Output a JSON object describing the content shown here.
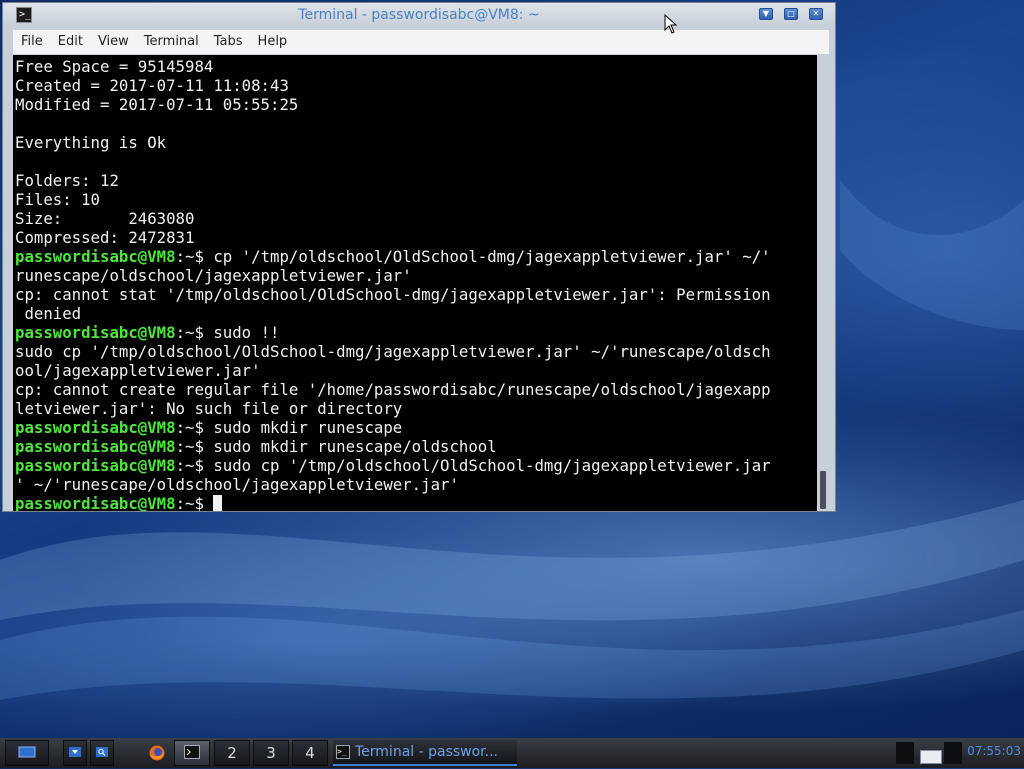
{
  "window": {
    "title": "Terminal - passwordisabc@VM8: ~",
    "icon": "terminal-icon"
  },
  "menu": [
    "File",
    "Edit",
    "View",
    "Terminal",
    "Tabs",
    "Help"
  ],
  "terminal": {
    "lines": [
      {
        "text": "Free Space = 95145984"
      },
      {
        "text": "Created = 2017-07-11 11:08:43"
      },
      {
        "text": "Modified = 2017-07-11 05:55:25"
      },
      {
        "text": ""
      },
      {
        "text": "Everything is Ok"
      },
      {
        "text": ""
      },
      {
        "text": "Folders: 12"
      },
      {
        "text": "Files: 10"
      },
      {
        "text": "Size:       2463080"
      },
      {
        "text": "Compressed: 2472831"
      },
      {
        "prompt": "passwordisabc@VM8",
        "path": ":~$ ",
        "text": "cp '/tmp/oldschool/OldSchool-dmg/jagexappletviewer.jar' ~/'"
      },
      {
        "text": "runescape/oldschool/jagexappletviewer.jar'"
      },
      {
        "text": "cp: cannot stat '/tmp/oldschool/OldSchool-dmg/jagexappletviewer.jar': Permission"
      },
      {
        "text": " denied"
      },
      {
        "prompt": "passwordisabc@VM8",
        "path": ":~$ ",
        "text": "sudo !!"
      },
      {
        "text": "sudo cp '/tmp/oldschool/OldSchool-dmg/jagexappletviewer.jar' ~/'runescape/oldsch"
      },
      {
        "text": "ool/jagexappletviewer.jar'"
      },
      {
        "text": "cp: cannot create regular file '/home/passwordisabc/runescape/oldschool/jagexapp"
      },
      {
        "text": "letviewer.jar': No such file or directory"
      },
      {
        "prompt": "passwordisabc@VM8",
        "path": ":~$ ",
        "text": "sudo mkdir runescape"
      },
      {
        "prompt": "passwordisabc@VM8",
        "path": ":~$ ",
        "text": "sudo mkdir runescape/oldschool"
      },
      {
        "prompt": "passwordisabc@VM8",
        "path": ":~$ ",
        "text": "sudo cp '/tmp/oldschool/OldSchool-dmg/jagexappletviewer.jar"
      },
      {
        "text": "' ~/'runescape/oldschool/jagexappletviewer.jar'"
      },
      {
        "prompt": "passwordisabc@VM8",
        "path": ":~$ ",
        "text": "",
        "cursor": true
      }
    ]
  },
  "taskbar": {
    "workspaces": [
      "2",
      "3",
      "4"
    ],
    "task_label": "Terminal - passwor...",
    "clock": "07:55:03"
  },
  "colors": {
    "prompt": "#4ee63c",
    "title_text": "#4a7fc1",
    "clock": "#4a90e2"
  }
}
